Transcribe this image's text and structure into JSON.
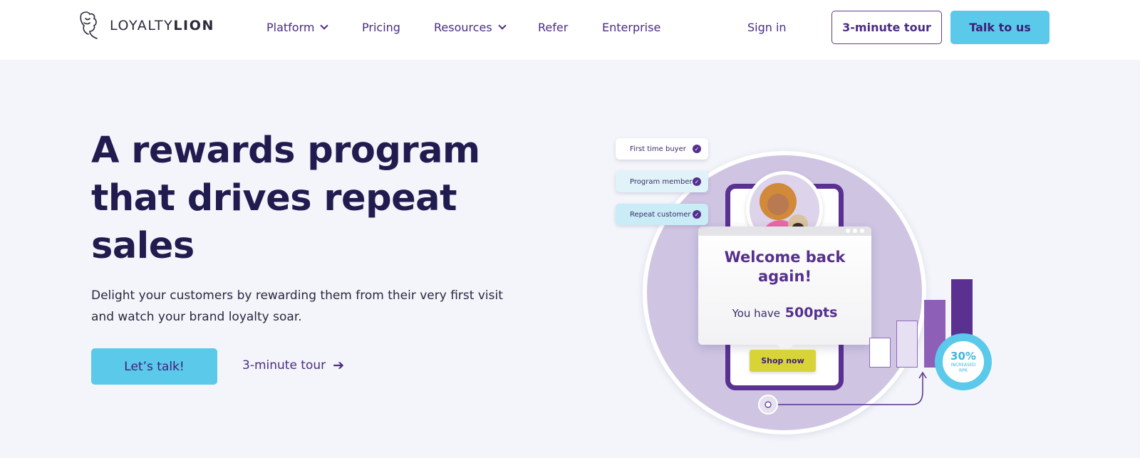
{
  "header": {
    "logo": {
      "text_light": "LOYALTY",
      "text_bold": "LION"
    },
    "nav": [
      {
        "label": "Platform",
        "has_dropdown": true
      },
      {
        "label": "Pricing",
        "has_dropdown": false
      },
      {
        "label": "Resources",
        "has_dropdown": true
      },
      {
        "label": "Refer",
        "has_dropdown": false
      },
      {
        "label": "Enterprise",
        "has_dropdown": false
      }
    ],
    "sign_in": "Sign in",
    "tour_button": "3-minute tour",
    "talk_button": "Talk to us"
  },
  "hero": {
    "headline_line1": "A rewards program",
    "headline_line2": "that drives repeat",
    "headline_line3": "sales",
    "subtext": "Delight your customers by rewarding them from their very first visit and watch your brand loyalty soar.",
    "cta_primary": "Let’s talk!",
    "cta_secondary": "3-minute tour",
    "cta_secondary_arrow": "➔"
  },
  "illustration": {
    "tags": [
      "First time buyer",
      "Program member",
      "Repeat customer"
    ],
    "card_title_line1": "Welcome back",
    "card_title_line2": "again!",
    "points_prefix": "You have",
    "points_value": "500pts",
    "shop_button": "Shop now",
    "badge_percent": "30%",
    "badge_label_line1": "INCREASED",
    "badge_label_line2": "RPR"
  },
  "colors": {
    "brand_purple": "#4b2c83",
    "accent_cyan": "#5bc9ea",
    "headline": "#211c4f",
    "background": "#f4f5fa"
  }
}
